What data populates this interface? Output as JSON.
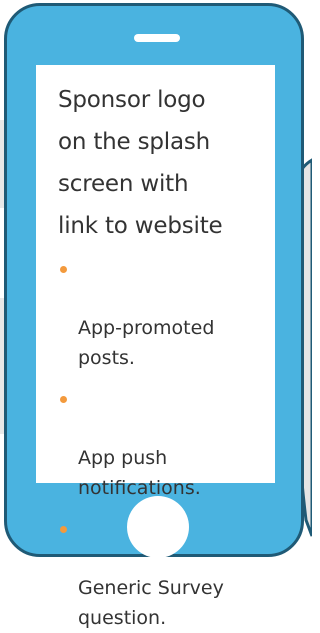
{
  "colors": {
    "phone_body": "#4ab3e0",
    "phone_border": "#1f5a76",
    "screen": "#ffffff",
    "text": "#333333",
    "bullet": "#f39a3d",
    "back_phone_fill": "#e5e5e5"
  },
  "screen": {
    "headline": "Sponsor logo\non the splash\nscreen with\nlink to website",
    "bullets": [
      "App-promoted\nposts.",
      "App push\nnotifications.",
      "Generic Survey\nquestion."
    ]
  },
  "icons": {
    "speaker": "speaker-slot-icon",
    "home": "home-button-icon",
    "bullet": "bullet-dot-icon"
  }
}
